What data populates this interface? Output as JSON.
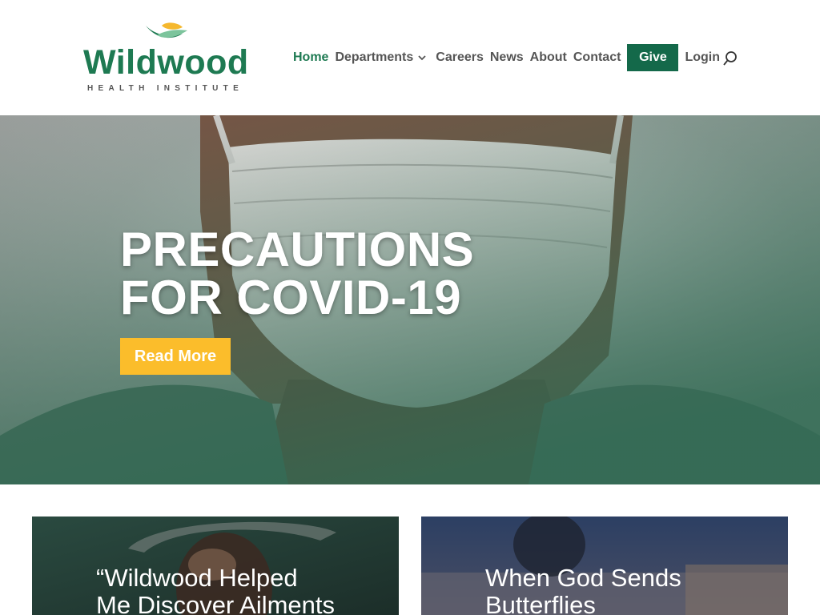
{
  "brand": {
    "name": "Wildwood",
    "subtitle": "HEALTH INSTITUTE",
    "colors": {
      "primary": "#1e7a52",
      "give": "#14694a",
      "accent": "#fbbd2b"
    }
  },
  "nav": {
    "items": [
      {
        "label": "Home",
        "active": true
      },
      {
        "label": "Departments",
        "has_dropdown": true
      },
      {
        "label": "Careers"
      },
      {
        "label": "News"
      },
      {
        "label": "About"
      },
      {
        "label": "Contact"
      }
    ],
    "give_label": "Give",
    "login_label": "Login",
    "search_icon": "search-icon"
  },
  "hero": {
    "title_line1": "PRECAUTIONS",
    "title_line2": "FOR  COVID-19",
    "button_label": "Read More"
  },
  "cards": [
    {
      "title_line1": "“Wildwood Helped",
      "title_line2": "Me Discover Ailments"
    },
    {
      "title_line1": "When God Sends",
      "title_line2": "Butterflies"
    }
  ]
}
